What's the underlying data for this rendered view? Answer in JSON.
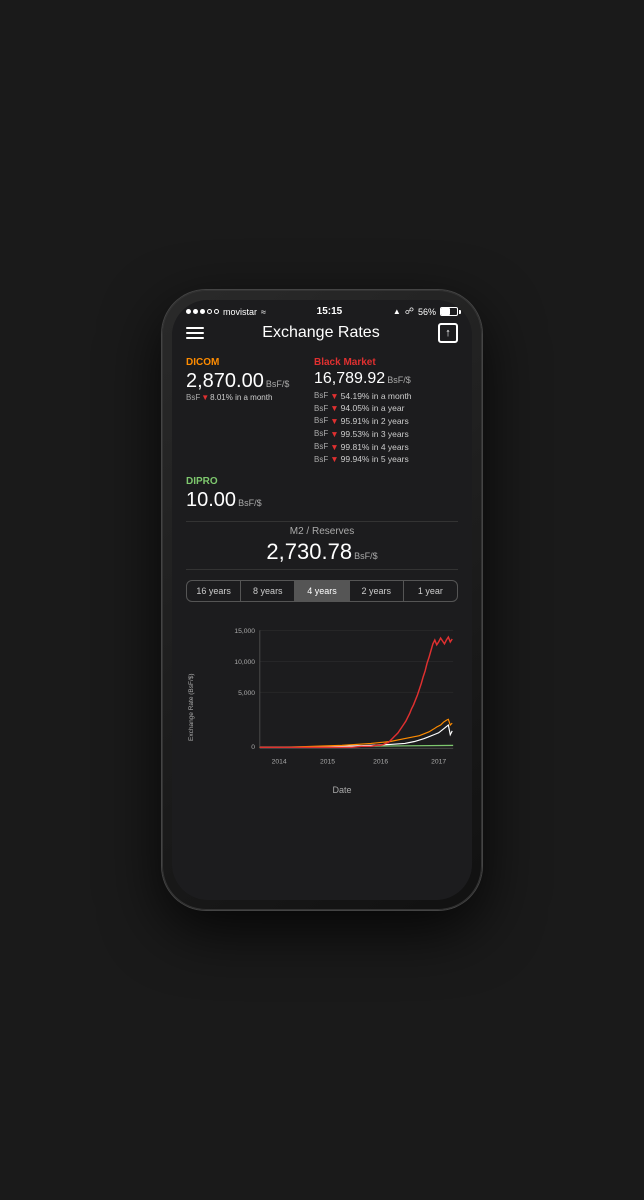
{
  "status": {
    "carrier": "movistar",
    "time": "15:15",
    "battery": "56%"
  },
  "nav": {
    "title": "Exchange Rates"
  },
  "dicom": {
    "label": "DICOM",
    "value": "2,870.00",
    "unit": "BsF/$",
    "change": "▼ 8.01% in a month"
  },
  "dipro": {
    "label": "DIPRO",
    "value": "10.00",
    "unit": "BsF/$"
  },
  "black_market": {
    "label": "Black Market",
    "value": "16,789.92",
    "unit": "BsF/$",
    "changes": [
      "BsF ▼ 54.19% in a month",
      "BsF ▼ 94.05% in a year",
      "BsF ▼ 95.91% in 2 years",
      "BsF ▼ 99.53% in 3 years",
      "BsF ▼ 99.81% in 4 years",
      "BsF ▼ 99.94% in 5 years"
    ]
  },
  "m2": {
    "label": "M2 / Reserves",
    "value": "2,730.78",
    "unit": "BsF/$"
  },
  "time_tabs": [
    {
      "label": "16 years",
      "active": false
    },
    {
      "label": "8 years",
      "active": false
    },
    {
      "label": "4 years",
      "active": true
    },
    {
      "label": "2 years",
      "active": false
    },
    {
      "label": "1 year",
      "active": false
    }
  ],
  "chart": {
    "y_label": "Exchange Rate (BsF/$)",
    "x_label": "Date",
    "y_ticks": [
      "15,000",
      "10,000",
      "5,000",
      "0"
    ],
    "x_ticks": [
      "2014",
      "2015",
      "2016",
      "2017"
    ],
    "colors": {
      "red_line": "#e03030",
      "white_line": "#fff",
      "green_line": "#7ec86e",
      "orange_line": "#ff8c00"
    }
  }
}
